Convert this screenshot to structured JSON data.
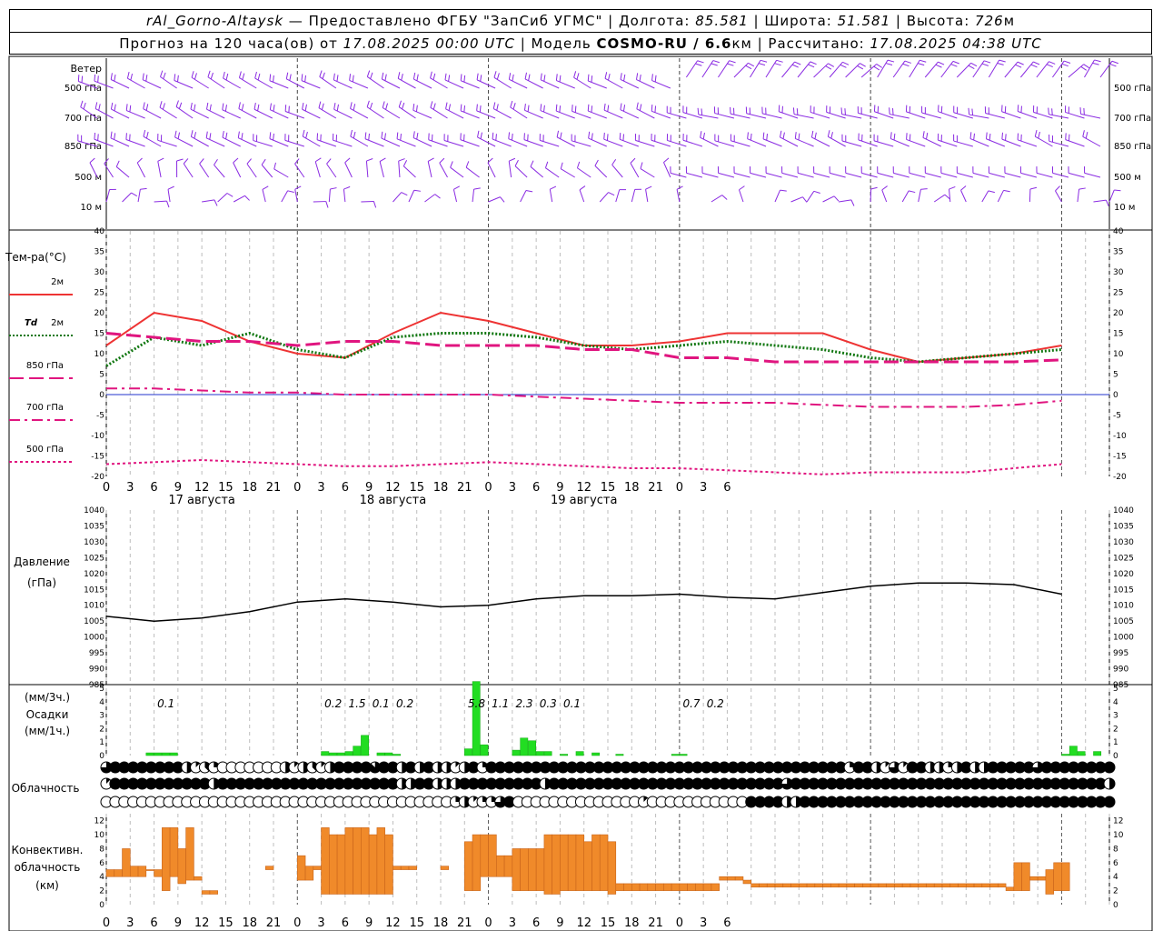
{
  "header": {
    "station": "rAl_Gorno-Altaysk",
    "provider": "— Предоставлено ФГБУ \"ЗапСиб УГМС\"",
    "lon_label": "Долгота:",
    "lon": "85.581",
    "lat_label": "Широта:",
    "lat": "51.581",
    "alt_label": "Высота:",
    "alt": "726",
    "alt_unit": "м",
    "forecast_prefix": "Прогноз на 120 часа(ов) от",
    "forecast_start": "17.08.2025 00:00 UTC",
    "model_label": "Модель",
    "model": "COSMO-RU / 6.6",
    "model_unit": "км",
    "calc_label": "Рассчитано:",
    "calc_time": "17.08.2025 04:38 UTC"
  },
  "colors": {
    "wind": "#8a2be2",
    "t2m": "#ee3333",
    "td2m": "#117711",
    "t850": "#e0157f",
    "t700": "#e0157f",
    "t500": "#e0157f",
    "precip": "#22dd22",
    "conv": "#f08a2a",
    "pressure": "#000000"
  },
  "wind": {
    "title": "Ветер",
    "levels": [
      "500 гПа",
      "700 гПа",
      "850 гПа",
      "500 м",
      "10 м"
    ]
  },
  "x_axis": {
    "hour_ticks": [
      "0",
      "3",
      "6",
      "9",
      "12",
      "15",
      "18",
      "21",
      "0",
      "3",
      "6",
      "9",
      "12",
      "15",
      "18",
      "21",
      "0",
      "3",
      "6",
      "9",
      "12",
      "15",
      "18",
      "21",
      "0",
      "3",
      "6"
    ],
    "day_labels": [
      "17 августа",
      "18 августа",
      "19 августа"
    ]
  },
  "chart_data": [
    {
      "type": "line",
      "title": "Тем-ра(°C)",
      "ylim": [
        -20,
        40
      ],
      "y_ticks": [
        "40",
        "35",
        "30",
        "25",
        "20",
        "15",
        "10",
        "5",
        "0",
        "-5",
        "-10",
        "-15",
        "-20"
      ],
      "x_hours": [
        0,
        6,
        12,
        18,
        24,
        30,
        36,
        42,
        48,
        54,
        60,
        66,
        72,
        78,
        84,
        90,
        96,
        102,
        108,
        114,
        120
      ],
      "series": [
        {
          "name": "2м",
          "values": [
            12,
            20,
            18,
            13,
            10,
            9,
            15,
            20,
            18,
            15,
            12,
            12,
            13,
            15,
            15,
            15,
            11,
            8,
            9,
            10,
            12
          ]
        },
        {
          "name": "Td 2м",
          "values": [
            7,
            14,
            12,
            15,
            11,
            9,
            14,
            15,
            15,
            14,
            12,
            11,
            12,
            13,
            12,
            11,
            9,
            8,
            9,
            10,
            11
          ]
        },
        {
          "name": "850 гПа",
          "values": [
            15,
            14,
            13,
            13,
            12,
            13,
            13,
            12,
            12,
            12,
            11,
            11,
            9,
            9,
            8,
            8,
            8,
            8,
            8,
            8,
            8.5
          ]
        },
        {
          "name": "700 гПа",
          "values": [
            1.5,
            1.5,
            1,
            0.5,
            0.5,
            0,
            0,
            0,
            0,
            -0.5,
            -1,
            -1.5,
            -2,
            -2,
            -2,
            -2.5,
            -3,
            -3,
            -3,
            -2.5,
            -1.5
          ]
        },
        {
          "name": "500 гПа",
          "values": [
            -17,
            -16.5,
            -16,
            -16.5,
            -17,
            -17.5,
            -17.5,
            -17,
            -16.5,
            -17,
            -17.5,
            -18,
            -18,
            -18.5,
            -19,
            -19.5,
            -19,
            -19,
            -19,
            -18,
            -17
          ]
        }
      ]
    },
    {
      "type": "line",
      "ylabel": "Давление (гПа)",
      "ylim": [
        985,
        1040
      ],
      "y_ticks": [
        "1040",
        "1035",
        "1030",
        "1025",
        "1020",
        "1015",
        "1010",
        "1005",
        "1000",
        "995",
        "990",
        "985"
      ],
      "x_hours": [
        0,
        6,
        12,
        18,
        24,
        30,
        36,
        42,
        48,
        54,
        60,
        66,
        72,
        78,
        84,
        90,
        96,
        102,
        108,
        114,
        120
      ],
      "series": [
        {
          "name": "",
          "values": [
            1006.5,
            1005,
            1006,
            1008,
            1011,
            1012,
            1011,
            1009.5,
            1010,
            1012,
            1013,
            1013,
            1013.5,
            1012.5,
            1012,
            1014,
            1016,
            1017,
            1017,
            1016.5,
            1013.5
          ]
        }
      ]
    },
    {
      "type": "bar",
      "ylabel": "Осадки",
      "ylabel_units_3h": "(мм/3ч.)",
      "ylabel_units_1h": "(мм/1ч.)",
      "ylim": [
        0,
        5
      ],
      "y_ticks": [
        "5",
        "4",
        "3",
        "2",
        "1",
        "0"
      ],
      "x_hours": [
        6,
        7,
        8,
        9,
        28,
        29,
        30,
        31,
        32,
        33,
        35,
        36,
        37,
        46,
        47,
        48,
        52,
        53,
        54,
        55,
        56,
        58,
        60,
        62,
        65,
        72,
        73,
        121,
        122,
        123,
        125
      ],
      "values": [
        0.2,
        0.2,
        0.2,
        0.2,
        0.3,
        0.2,
        0.2,
        0.3,
        0.7,
        1.5,
        0.2,
        0.2,
        0.1,
        0.5,
        5.5,
        0.8,
        0.4,
        1.3,
        1.1,
        0.3,
        0.3,
        0.1,
        0.3,
        0.2,
        0.1,
        0.1,
        0.1,
        0.1,
        0.7,
        0.3,
        0.3
      ],
      "labels_3h": [
        {
          "hour": 7.5,
          "text": "0.1"
        },
        {
          "hour": 28.5,
          "text": "0.2"
        },
        {
          "hour": 31.5,
          "text": "1.5"
        },
        {
          "hour": 34.5,
          "text": "0.1"
        },
        {
          "hour": 37.5,
          "text": "0.2"
        },
        {
          "hour": 46.5,
          "text": "5.8"
        },
        {
          "hour": 49.5,
          "text": "1.1"
        },
        {
          "hour": 52.5,
          "text": "2.3"
        },
        {
          "hour": 55.5,
          "text": "0.3"
        },
        {
          "hour": 58.5,
          "text": "0.1"
        },
        {
          "hour": 73.5,
          "text": "0.7"
        },
        {
          "hour": 76.5,
          "text": "0.2"
        }
      ]
    },
    {
      "type": "table",
      "title": "Облачность",
      "rows": [
        "upper",
        "middle",
        "lower"
      ],
      "upper": [
        6,
        8,
        8,
        8,
        8,
        8,
        8,
        8,
        8,
        4,
        1,
        3,
        2,
        0,
        0,
        0,
        0,
        0,
        0,
        0,
        4,
        1,
        4,
        3,
        1,
        4,
        8,
        8,
        8,
        8,
        7,
        8,
        8,
        4,
        8,
        4,
        8,
        4,
        4,
        1,
        4,
        8,
        2,
        8,
        8,
        8,
        8,
        8,
        8,
        8,
        8,
        8,
        8,
        8,
        8,
        8,
        8,
        8,
        8,
        8,
        8,
        8,
        8,
        8,
        8,
        8,
        8,
        8,
        8,
        8,
        8,
        8,
        8,
        8,
        8,
        8,
        8,
        8,
        8,
        8,
        8,
        8,
        8,
        2,
        8,
        8,
        4,
        1,
        6,
        1,
        8,
        8,
        4,
        4,
        2,
        4,
        8,
        4,
        4,
        8,
        8,
        8,
        8,
        8,
        6,
        8,
        8,
        8,
        8,
        8,
        8,
        8,
        8
      ],
      "middle": [
        1,
        8,
        8,
        8,
        8,
        8,
        8,
        8,
        8,
        8,
        8,
        8,
        4,
        8,
        8,
        8,
        8,
        8,
        8,
        8,
        8,
        8,
        8,
        8,
        8,
        8,
        8,
        8,
        8,
        8,
        8,
        8,
        8,
        4,
        4,
        8,
        8,
        4,
        4,
        4,
        8,
        8,
        8,
        8,
        8,
        8,
        8,
        8,
        8,
        4,
        8,
        8,
        8,
        8,
        8,
        8,
        8,
        8,
        8,
        8,
        8,
        8,
        8,
        8,
        8,
        8,
        8,
        8,
        8,
        8,
        8,
        8,
        8,
        8,
        8,
        8,
        6,
        8,
        8,
        8,
        8,
        8,
        8,
        8,
        8,
        8,
        8,
        8,
        8,
        8,
        8,
        8,
        8,
        8,
        8,
        8,
        8,
        8,
        8,
        8,
        8,
        8,
        8,
        8,
        8,
        8,
        8,
        8,
        8,
        8,
        8,
        8,
        4
      ],
      "lower": [
        0,
        0,
        0,
        0,
        0,
        0,
        0,
        0,
        0,
        0,
        0,
        0,
        0,
        0,
        0,
        0,
        0,
        0,
        0,
        0,
        0,
        0,
        0,
        0,
        0,
        0,
        0,
        0,
        0,
        0,
        0,
        0,
        0,
        0,
        0,
        0,
        0,
        0,
        0,
        2,
        4,
        1,
        2,
        2,
        6,
        8,
        0,
        0,
        0,
        0,
        0,
        0,
        0,
        0,
        0,
        0,
        0,
        0,
        0,
        0,
        1,
        0,
        0,
        0,
        0,
        0,
        0,
        0,
        0,
        0,
        0,
        0,
        8,
        8,
        8,
        8,
        4,
        4,
        8,
        8,
        8,
        8,
        8,
        8,
        8,
        8,
        8,
        8,
        8,
        8,
        8,
        8,
        8,
        8,
        8,
        8,
        8,
        8,
        8,
        8,
        8,
        8,
        8,
        8,
        8,
        8,
        8,
        8,
        8,
        8,
        8,
        8,
        8
      ]
    },
    {
      "type": "bar",
      "ylabel": "Конвективн. облачность (км)",
      "ylim": [
        0,
        13
      ],
      "y_ticks": [
        "12",
        "10",
        "8",
        "6",
        "4",
        "2",
        "0"
      ],
      "x_hours": [
        0,
        1,
        2,
        3,
        4,
        5,
        6,
        7,
        8,
        9,
        10,
        11,
        12,
        13,
        20,
        24,
        25,
        26,
        27,
        28,
        29,
        30,
        31,
        32,
        33,
        34,
        35,
        36,
        37,
        38,
        42,
        45,
        46,
        47,
        48,
        49,
        50,
        51,
        52,
        53,
        54,
        55,
        56,
        57,
        58,
        59,
        60,
        61,
        62,
        63,
        64,
        65,
        66,
        67,
        68,
        69,
        70,
        71,
        72,
        73,
        74,
        75,
        76,
        77,
        78,
        79,
        80,
        81,
        82,
        83,
        84,
        85,
        86,
        87,
        88,
        89,
        90,
        91,
        92,
        93,
        94,
        95,
        96,
        97,
        98,
        99,
        100,
        101,
        102,
        103,
        104,
        105,
        106,
        107,
        108,
        109,
        110,
        111,
        112,
        113,
        114,
        115,
        116,
        117,
        118,
        119,
        120
      ],
      "bars": [
        [
          4,
          5
        ],
        [
          4,
          5
        ],
        [
          4,
          8
        ],
        [
          4,
          5.5
        ],
        [
          4,
          5.5
        ],
        [
          5,
          5
        ],
        [
          4,
          5
        ],
        [
          2,
          11
        ],
        [
          4,
          11
        ],
        [
          3,
          8
        ],
        [
          3.5,
          11
        ],
        [
          3.5,
          4
        ],
        [
          1.5,
          2
        ],
        [
          1.5,
          2
        ],
        [
          5,
          5.5
        ],
        [
          3.5,
          7
        ],
        [
          3.5,
          5.5
        ],
        [
          5,
          5.5
        ],
        [
          1.5,
          11
        ],
        [
          1.5,
          10
        ],
        [
          1.5,
          10
        ],
        [
          1.5,
          11
        ],
        [
          1.5,
          11
        ],
        [
          1.5,
          11
        ],
        [
          1.5,
          10
        ],
        [
          1.5,
          11
        ],
        [
          1.5,
          10
        ],
        [
          5,
          5.5
        ],
        [
          5,
          5.5
        ],
        [
          5,
          5.5
        ],
        [
          5,
          5.5
        ],
        [
          2,
          9
        ],
        [
          2,
          10
        ],
        [
          4,
          10
        ],
        [
          4,
          10
        ],
        [
          4,
          7
        ],
        [
          4,
          7
        ],
        [
          2,
          8
        ],
        [
          2,
          8
        ],
        [
          2,
          8
        ],
        [
          2,
          8
        ],
        [
          1.5,
          10
        ],
        [
          1.5,
          10
        ],
        [
          2,
          10
        ],
        [
          2,
          10
        ],
        [
          2,
          10
        ],
        [
          2,
          9
        ],
        [
          2,
          10
        ],
        [
          2,
          10
        ],
        [
          1.5,
          9
        ],
        [
          2,
          3
        ],
        [
          2,
          3
        ],
        [
          2,
          3
        ],
        [
          2,
          3
        ],
        [
          2,
          3
        ],
        [
          2,
          3
        ],
        [
          2,
          3
        ],
        [
          2,
          3
        ],
        [
          2,
          3
        ],
        [
          2,
          3
        ],
        [
          2,
          3
        ],
        [
          2,
          3
        ],
        [
          2,
          3
        ],
        [
          3.5,
          4
        ],
        [
          3.5,
          4
        ],
        [
          3.5,
          4
        ],
        [
          3,
          3.5
        ],
        [
          2.5,
          3
        ],
        [
          2.5,
          3
        ],
        [
          2.5,
          3
        ],
        [
          2.5,
          3
        ],
        [
          2.5,
          3
        ],
        [
          2.5,
          3
        ],
        [
          2.5,
          3
        ],
        [
          2.5,
          3
        ],
        [
          2.5,
          3
        ],
        [
          2.5,
          3
        ],
        [
          2.5,
          3
        ],
        [
          2.5,
          3
        ],
        [
          2.5,
          3
        ],
        [
          2.5,
          3
        ],
        [
          2.5,
          3
        ],
        [
          2.5,
          3
        ],
        [
          2.5,
          3
        ],
        [
          2.5,
          3
        ],
        [
          2.5,
          3
        ],
        [
          2.5,
          3
        ],
        [
          2.5,
          3
        ],
        [
          2.5,
          3
        ],
        [
          2.5,
          3
        ],
        [
          2.5,
          3
        ],
        [
          2.5,
          3
        ],
        [
          2.5,
          3
        ],
        [
          2.5,
          3
        ],
        [
          2.5,
          3
        ],
        [
          2.5,
          3
        ],
        [
          2.5,
          3
        ],
        [
          2.5,
          3
        ],
        [
          2.5,
          3
        ],
        [
          2,
          2.5
        ],
        [
          2,
          6
        ],
        [
          2,
          6
        ],
        [
          3.5,
          4
        ],
        [
          3.5,
          4
        ],
        [
          1.5,
          5
        ],
        [
          2,
          6
        ],
        [
          2,
          6
        ]
      ]
    }
  ],
  "legend": {
    "t2m": "2м",
    "td_symbol": "Td",
    "td_level": "2м",
    "t850": "850 гПа",
    "t700": "700 гПа",
    "t500": "500 гПа"
  },
  "labels": {
    "temperature": "Тем-ра(°C)",
    "pressure_1": "Давление",
    "pressure_2": "(гПа)",
    "precip_units_3h": "(мм/3ч.)",
    "precip_title": "Осадки",
    "precip_units_1h": "(мм/1ч.)",
    "clouds": "Облачность",
    "conv_1": "Конвективн.",
    "conv_2": "облачность",
    "conv_3": "(км)"
  }
}
